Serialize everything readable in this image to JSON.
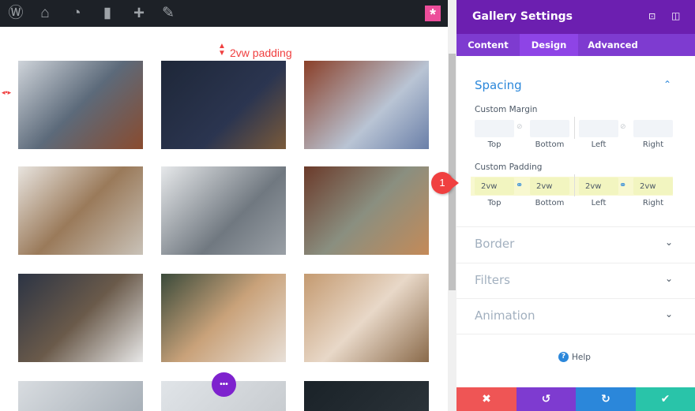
{
  "toolbar": {
    "icons": [
      "wordpress-icon",
      "sites-icon",
      "dashboard-icon",
      "comment-icon",
      "plus-icon",
      "pencil-icon"
    ],
    "builder_icon": "*"
  },
  "annotation": {
    "padding_label": "2vw padding",
    "badge": "1"
  },
  "gallery": {
    "more_button": "•••"
  },
  "panel": {
    "title": "Gallery Settings",
    "tabs": [
      "Content",
      "Design",
      "Advanced"
    ],
    "spacing": {
      "title": "Spacing",
      "margin_label": "Custom Margin",
      "padding_label": "Custom Padding",
      "margin_values": [
        "",
        "",
        "",
        ""
      ],
      "padding_values": [
        "2vw",
        "2vw",
        "2vw",
        "2vw"
      ],
      "sides": [
        "Top",
        "Bottom",
        "Left",
        "Right"
      ]
    },
    "sections": [
      "Border",
      "Filters",
      "Animation"
    ],
    "help": "Help"
  },
  "colors": {
    "purple": "#6c1fb0",
    "accent": "#2b87da",
    "cancel": "#ef5555",
    "save": "#29c4a9"
  }
}
